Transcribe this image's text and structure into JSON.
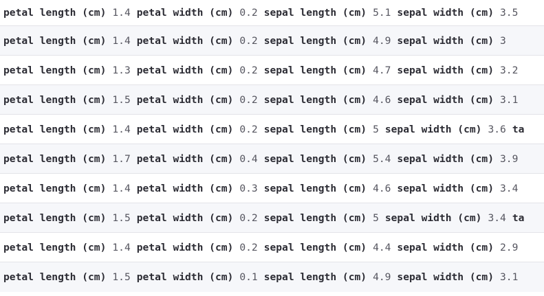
{
  "labels": {
    "petal_length": "petal length (cm)",
    "petal_width": "petal width (cm)",
    "sepal_length": "sepal length (cm)",
    "sepal_width": "sepal width (cm)",
    "target_cut": "ta"
  },
  "rows": [
    {
      "petal_length": "1.4",
      "petal_width": "0.2",
      "sepal_length": "5.1",
      "sepal_width": "3.5"
    },
    {
      "petal_length": "1.4",
      "petal_width": "0.2",
      "sepal_length": "4.9",
      "sepal_width": "3"
    },
    {
      "petal_length": "1.3",
      "petal_width": "0.2",
      "sepal_length": "4.7",
      "sepal_width": "3.2"
    },
    {
      "petal_length": "1.5",
      "petal_width": "0.2",
      "sepal_length": "4.6",
      "sepal_width": "3.1"
    },
    {
      "petal_length": "1.4",
      "petal_width": "0.2",
      "sepal_length": "5",
      "sepal_width": "3.6"
    },
    {
      "petal_length": "1.7",
      "petal_width": "0.4",
      "sepal_length": "5.4",
      "sepal_width": "3.9"
    },
    {
      "petal_length": "1.4",
      "petal_width": "0.3",
      "sepal_length": "4.6",
      "sepal_width": "3.4"
    },
    {
      "petal_length": "1.5",
      "petal_width": "0.2",
      "sepal_length": "5",
      "sepal_width": "3.4"
    },
    {
      "petal_length": "1.4",
      "petal_width": "0.2",
      "sepal_length": "4.4",
      "sepal_width": "2.9"
    },
    {
      "petal_length": "1.5",
      "petal_width": "0.1",
      "sepal_length": "4.9",
      "sepal_width": "3.1"
    }
  ]
}
